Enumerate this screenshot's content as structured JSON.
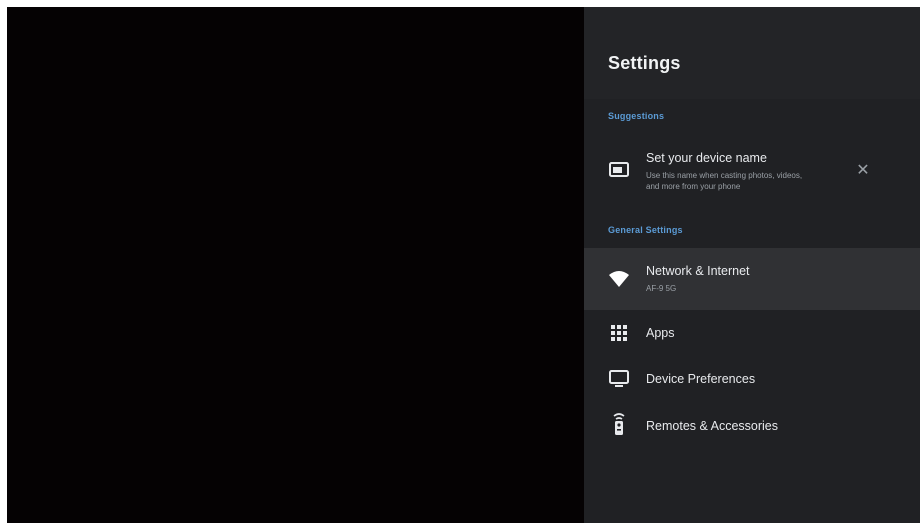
{
  "settings": {
    "title": "Settings",
    "suggestions_label": "Suggestions",
    "suggestion": {
      "title": "Set your device name",
      "subtitle_line1": "Use this name when casting photos, videos,",
      "subtitle_line2": "and more from your phone",
      "icon": "cast-icon",
      "dismiss_icon": "close-icon"
    },
    "general_label": "General Settings",
    "items": [
      {
        "label": "Network & Internet",
        "sublabel": "AF-9 5G",
        "icon": "wifi-icon",
        "focused": true
      },
      {
        "label": "Apps",
        "icon": "apps-grid-icon"
      },
      {
        "label": "Device Preferences",
        "icon": "tv-icon"
      },
      {
        "label": "Remotes & Accessories",
        "icon": "remote-icon"
      }
    ]
  },
  "colors": {
    "panel_bg": "#202124",
    "focused_bg": "#303134",
    "section_label": "#5b9bd5",
    "screen_bg": "#050203"
  }
}
